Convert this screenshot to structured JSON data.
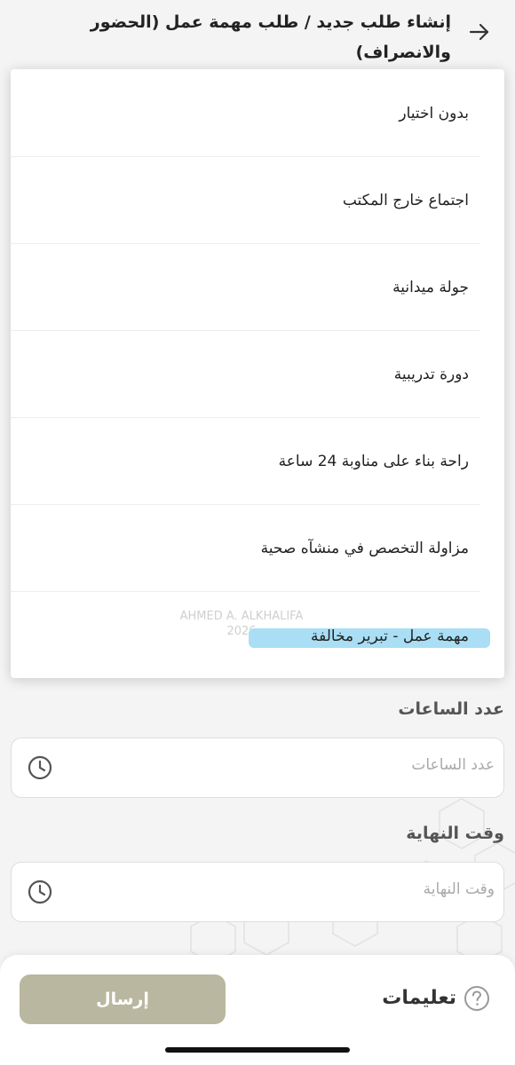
{
  "header": {
    "title": "إنشاء طلب جديد / طلب مهمة عمل (الحضور والانصراف)"
  },
  "dropdown": {
    "options": [
      "بدون اختيار",
      "اجتماع خارج المكتب",
      "جولة ميدانية",
      "دورة تدريبية",
      "راحة بناء على مناوبة 24 ساعة",
      "مزاولة التخصص في منشآه صحية",
      "مهمة عمل - تبرير مخالفة"
    ],
    "watermark_line1": "AHMED A. ALKHALIFA",
    "watermark_line2": "2026"
  },
  "hours": {
    "label": "عدد الساعات",
    "placeholder": "عدد الساعات"
  },
  "end_time": {
    "label": "وقت النهاية",
    "placeholder": "وقت النهاية"
  },
  "bottom": {
    "submit_label": "إرسال",
    "instructions_label": "تعليمات"
  },
  "colors": {
    "submit_bg": "#bab7a0",
    "highlight": "#a9def5",
    "background": "#f4f4f4"
  },
  "icons": {
    "back": "arrow-right-icon",
    "clock": "clock-icon",
    "help": "question-circle-icon"
  }
}
